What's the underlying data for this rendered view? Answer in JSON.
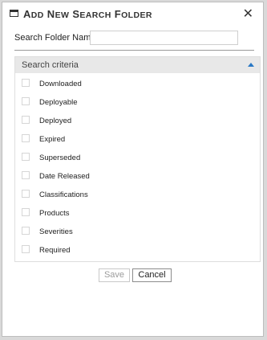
{
  "dialog": {
    "title_first": "A",
    "title_first_rest": "DD",
    "title_second": "N",
    "title_second_rest": "EW",
    "title_third": "S",
    "title_third_rest": "EARCH",
    "title_fourth": "F",
    "title_fourth_rest": "OLDER",
    "close_glyph": "✕"
  },
  "form": {
    "name_label": "Search Folder Name:",
    "name_value": "",
    "name_placeholder": ""
  },
  "criteria": {
    "header": "Search criteria",
    "items": [
      {
        "label": "Downloaded",
        "checked": false
      },
      {
        "label": "Deployable",
        "checked": false
      },
      {
        "label": "Deployed",
        "checked": false
      },
      {
        "label": "Expired",
        "checked": false
      },
      {
        "label": "Superseded",
        "checked": false
      },
      {
        "label": "Date Released",
        "checked": false
      },
      {
        "label": "Classifications",
        "checked": false
      },
      {
        "label": "Products",
        "checked": false
      },
      {
        "label": "Severities",
        "checked": false
      },
      {
        "label": "Required",
        "checked": false
      }
    ]
  },
  "buttons": {
    "save": "Save",
    "cancel": "Cancel"
  },
  "colors": {
    "accent": "#2a78c5",
    "header_bg": "#e8e8e8",
    "disabled_text": "#9c9c9c"
  }
}
